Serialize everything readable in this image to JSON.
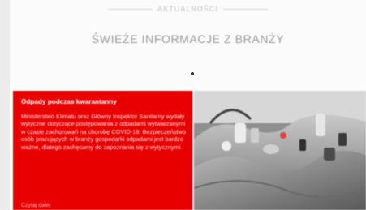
{
  "header": {
    "nav_text": "AKTUALNOŚCI"
  },
  "section": {
    "title": "ŚWIEŻE INFORMACJE Z BRANŻY"
  },
  "article": {
    "title": "Odpady podczas kwarantanny",
    "body": "Ministerstwo Klimatu oraz Główny Inspektor Sanitarny wydały wytyczne dotyczące postępowania z odpadami wytwarzanymi w czasie zachorowań na chorobę COVID-19. Bezpieczeństwo osób pracujących w branży gospodarki odpadami jest bardzo ważne, dlatego zachęcamy do zapoznania się z wytycznymi.",
    "read_more": "Czytaj dalej"
  },
  "colors": {
    "accent": "#e80000",
    "page_bg": "#fbfbfb"
  },
  "icons": {
    "carousel_dot": "dot-indicator"
  }
}
